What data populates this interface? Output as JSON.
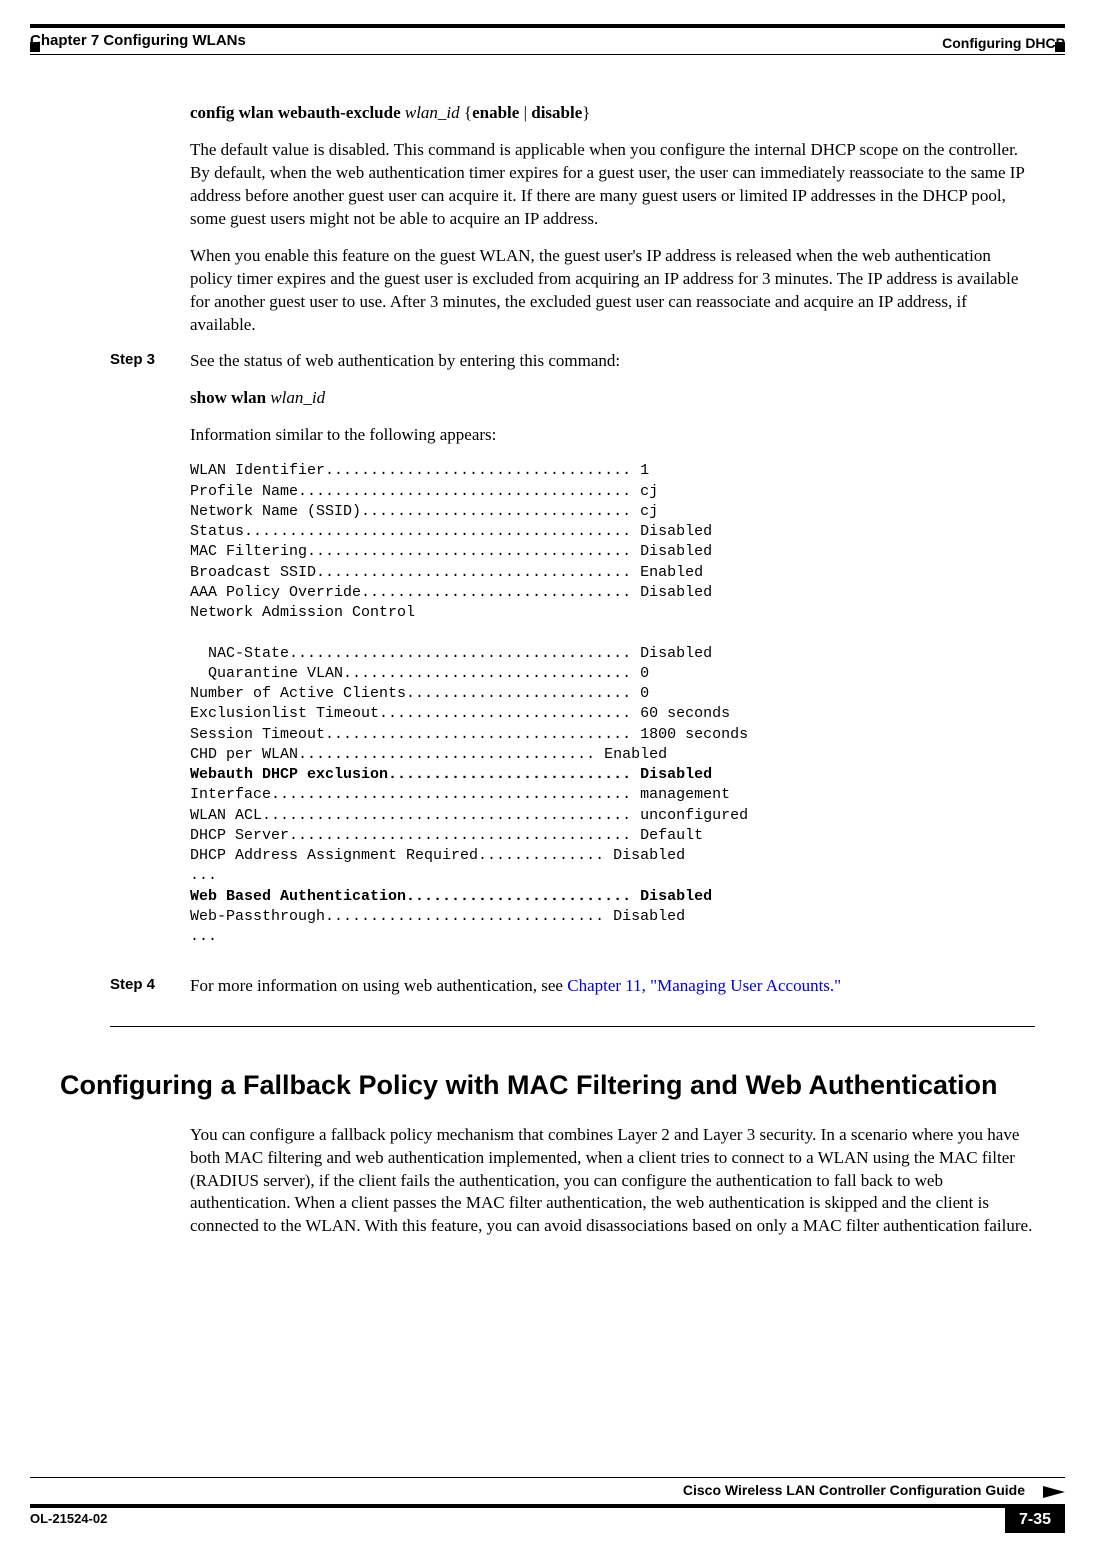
{
  "header": {
    "left": "Chapter 7      Configuring WLANs",
    "right": "Configuring DHCP"
  },
  "cmd1": {
    "p1": "config wlan webauth-exclude ",
    "p2": "wlan_id ",
    "p3": "{",
    "p4": "enable",
    "p5": " | ",
    "p6": "disable",
    "p7": "}"
  },
  "para1": "The default value is disabled. This command is applicable when you configure the internal DHCP scope on the controller. By default, when the web authentication timer expires for a guest user, the user can immediately reassociate to the same IP address before another guest user can acquire it. If there are many guest users or limited IP addresses in the DHCP pool, some guest users might not be able to acquire an IP address.",
  "para2": "When you enable this feature on the guest WLAN, the guest user's IP address is released when the web authentication policy timer expires and the guest user is excluded from acquiring an IP address for 3 minutes. The IP address is available for another guest user to use. After 3 minutes, the excluded guest user can reassociate and acquire an IP address, if available.",
  "step3": {
    "label": "Step 3",
    "sentence": "See the status of web authentication by entering this command:",
    "cmd_b": "show wlan ",
    "cmd_i": "wlan_id",
    "info": "Information similar to the following appears:"
  },
  "cli": {
    "l1": "WLAN Identifier.................................. 1",
    "l2": "Profile Name..................................... cj",
    "l3": "Network Name (SSID).............................. cj",
    "l4": "Status........................................... Disabled",
    "l5": "MAC Filtering.................................... Disabled",
    "l6": "Broadcast SSID................................... Enabled",
    "l7": "AAA Policy Override.............................. Disabled",
    "l8": "Network Admission Control",
    "l9": "",
    "l10": "  NAC-State...................................... Disabled",
    "l11": "  Quarantine VLAN................................ 0",
    "l12": "Number of Active Clients......................... 0",
    "l13": "Exclusionlist Timeout............................ 60 seconds",
    "l14": "Session Timeout.................................. 1800 seconds",
    "l15": "CHD per WLAN................................. Enabled",
    "l16": "Webauth DHCP exclusion........................... Disabled",
    "l17": "Interface........................................ management",
    "l18": "WLAN ACL......................................... unconfigured",
    "l19": "DHCP Server...................................... Default",
    "l20": "DHCP Address Assignment Required.............. Disabled",
    "l21": "...",
    "l22": "Web Based Authentication......................... Disabled",
    "l23": "Web-Passthrough............................... Disabled",
    "l24": "..."
  },
  "step4": {
    "label": "Step 4",
    "text_a": "For more information on using web authentication, see ",
    "link": "Chapter 11, \"Managing User Accounts.\""
  },
  "h2": "Configuring a Fallback Policy with MAC Filtering and Web Authentication",
  "para3": "You can configure a fallback policy mechanism that combines Layer 2 and Layer 3 security. In a scenario where you have both MAC filtering and web authentication implemented, when a client tries to connect to a WLAN using the MAC filter (RADIUS server), if the client fails the authentication, you can configure the authentication to fall back to web authentication. When a client passes the MAC filter authentication, the web authentication is skipped and the client is connected to the WLAN. With this feature, you can avoid disassociations based on only a MAC filter authentication failure.",
  "footer": {
    "guide": "Cisco Wireless LAN Controller Configuration Guide",
    "doc": "OL-21524-02",
    "page": "7-35"
  }
}
